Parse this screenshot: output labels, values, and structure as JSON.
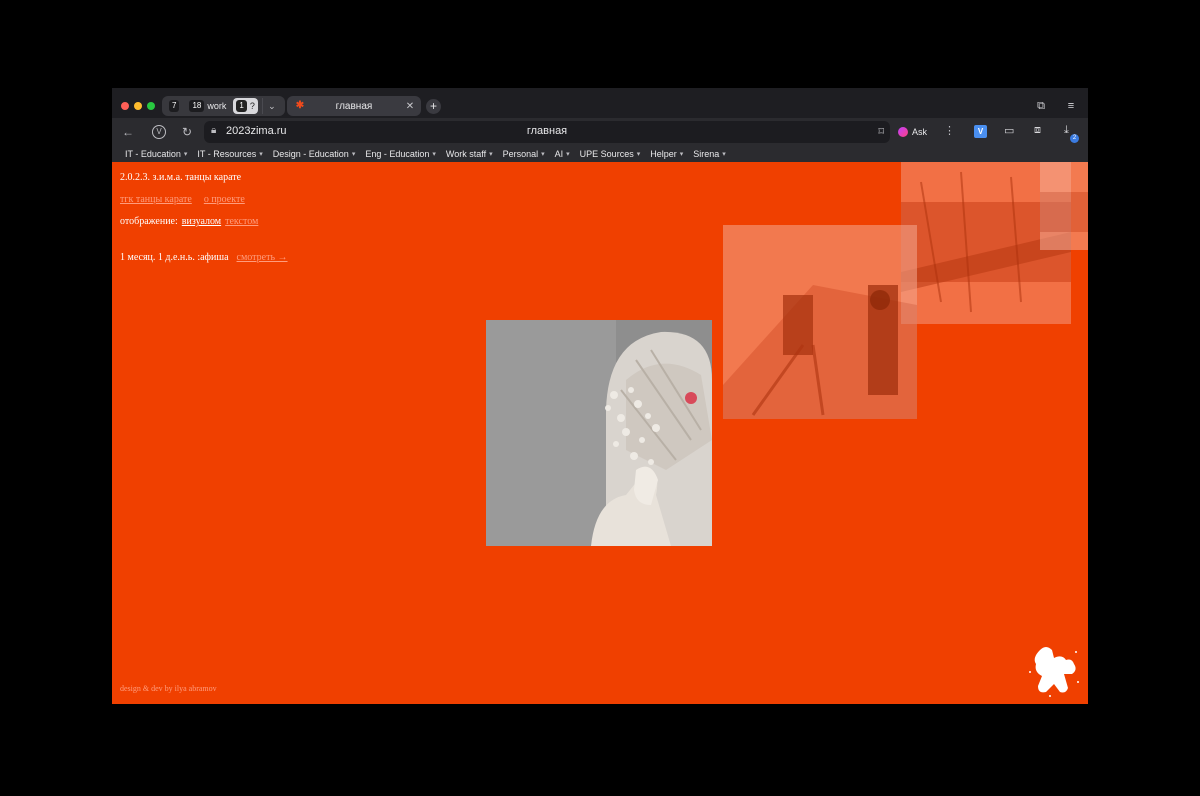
{
  "browser": {
    "workspaces": [
      {
        "num": "7",
        "label": ""
      },
      {
        "num": "18",
        "label": "work"
      },
      {
        "num": "1",
        "label": "?"
      }
    ],
    "tab": {
      "title": "главная"
    },
    "url": {
      "host": "2023zima.ru"
    },
    "page_title": "главная",
    "ask_label": "Ask",
    "downloads_badge": "2",
    "bookmarks": [
      "IT - Education",
      "IT - Resources",
      "Design - Education",
      "Eng - Education",
      "Work staff",
      "Personal",
      "AI",
      "UPE Sources",
      "Helper",
      "Sirena"
    ]
  },
  "page": {
    "title": "2.0.2.3. з.и.м.а. танцы карате",
    "links": [
      "тгк танцы карате",
      "о проекте"
    ],
    "display_label": "отображение:",
    "display_active": "визуалом",
    "display_other": "текстом",
    "afisha_text": "1 месяц. 1 д.е.н.ь. :афиша",
    "afisha_link": "смотреть →",
    "footer": "design & dev by ilya abramov"
  },
  "colors": {
    "page_bg": "#f04000",
    "link": "#ff9c7c",
    "chrome_bg": "#2b2b2f"
  }
}
